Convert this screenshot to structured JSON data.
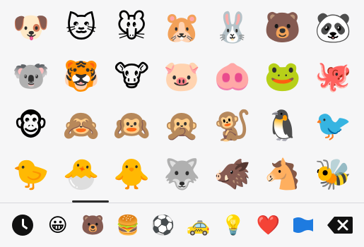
{
  "emoji_grid": {
    "rows": [
      [
        "🐶",
        "🐱",
        "🐭",
        "🐹",
        "🐰",
        "🐻",
        "🐼"
      ],
      [
        "🐨",
        "🐯",
        "🐮",
        "🐷",
        "🐽",
        "🐸",
        "🐙"
      ],
      [
        "🐵",
        "🙈",
        "🙉",
        "🙊",
        "🐒",
        "🐧",
        "🐦"
      ],
      [
        "🐤",
        "🐣",
        "🐥",
        "🐺",
        "🐗",
        "🐴",
        "🐝"
      ]
    ]
  },
  "category_bar": {
    "active_index": 2,
    "items": [
      {
        "name": "recent-icon",
        "glyph": ""
      },
      {
        "name": "smileys-icon",
        "glyph": "😀"
      },
      {
        "name": "animals-nature-icon",
        "glyph": "🐻"
      },
      {
        "name": "food-drink-icon",
        "glyph": "🍔"
      },
      {
        "name": "activity-icon",
        "glyph": "⚽"
      },
      {
        "name": "travel-places-icon",
        "glyph": "🚕"
      },
      {
        "name": "objects-icon",
        "glyph": "💡"
      },
      {
        "name": "symbols-icon",
        "glyph": "❤️"
      },
      {
        "name": "flags-icon",
        "glyph": ""
      }
    ]
  },
  "colors": {
    "keyboard_bg": "#f6f6f7",
    "indicator": "#2b2b2b",
    "flag_blue": "#1e7be0"
  }
}
